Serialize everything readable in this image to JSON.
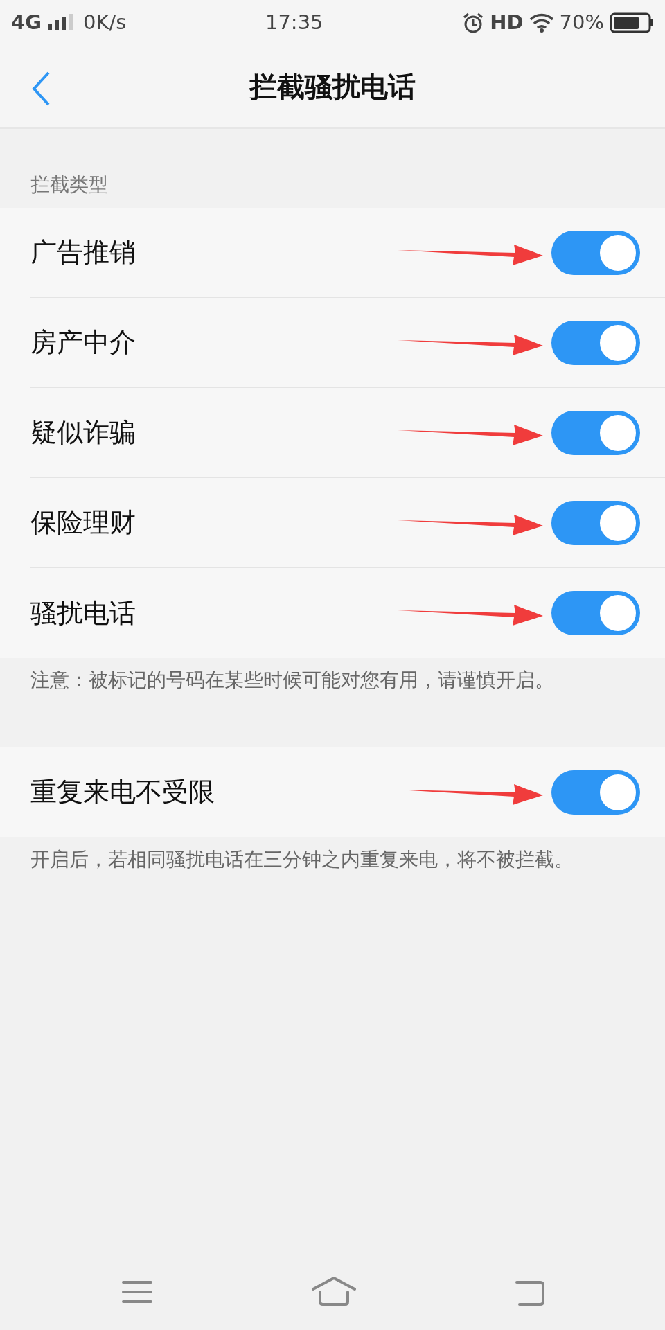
{
  "status_bar": {
    "network": "4G",
    "speed": "0K/s",
    "time": "17:35",
    "hd": "HD",
    "battery": "70%"
  },
  "header": {
    "title": "拦截骚扰电话"
  },
  "sections": [
    {
      "label": "拦截类型",
      "items": [
        {
          "label": "广告推销",
          "on": true,
          "marked": true
        },
        {
          "label": "房产中介",
          "on": true,
          "marked": true
        },
        {
          "label": "疑似诈骗",
          "on": true,
          "marked": true
        },
        {
          "label": "保险理财",
          "on": true,
          "marked": true
        },
        {
          "label": "骚扰电话",
          "on": true,
          "marked": true
        }
      ],
      "note": "注意：被标记的号码在某些时候可能对您有用，请谨慎开启。"
    },
    {
      "items": [
        {
          "label": "重复来电不受限",
          "on": true,
          "marked": true
        }
      ],
      "note": "开启后，若相同骚扰电话在三分钟之内重复来电，将不被拦截。"
    }
  ]
}
